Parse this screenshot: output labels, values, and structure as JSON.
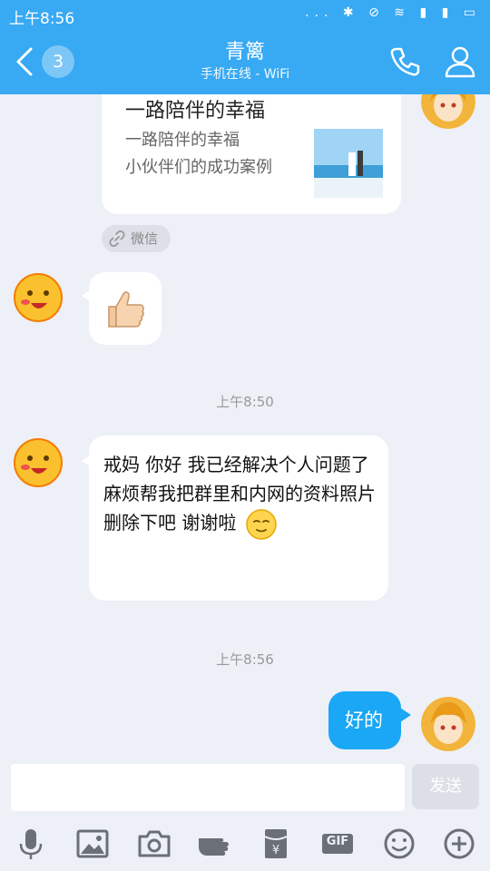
{
  "status_bar": {
    "time": "上午8:56",
    "icons_text": "... ✱ ⊘ ≋ ▮ ▮ ▭"
  },
  "header": {
    "back_badge": "3",
    "title": "青篱",
    "subtitle": "手机在线 - WiFi"
  },
  "shared_card": {
    "title": "一路陪伴的幸福",
    "desc_line1": "一路陪伴的幸福",
    "desc_line2": "小伙伴们的成功案例",
    "source": "微信"
  },
  "messages": [
    {
      "side": "in",
      "type": "emoji",
      "content": "thumbs-up"
    },
    {
      "timestamp": "上午8:50"
    },
    {
      "side": "in",
      "type": "text",
      "text": "戒妈 你好 我已经解决个人问题了 麻烦帮我把群里和内网的资料照片删除下吧 谢谢啦"
    },
    {
      "timestamp": "上午8:56"
    },
    {
      "side": "out",
      "type": "text",
      "text": "好的"
    }
  ],
  "input": {
    "send_label": "发送",
    "placeholder": ""
  },
  "toolbar": {
    "gif_label": "GIF"
  },
  "colors": {
    "header_bg": "#38a9f3",
    "bubble_out": "#1aa7f5",
    "bg": "#eef0f7"
  }
}
